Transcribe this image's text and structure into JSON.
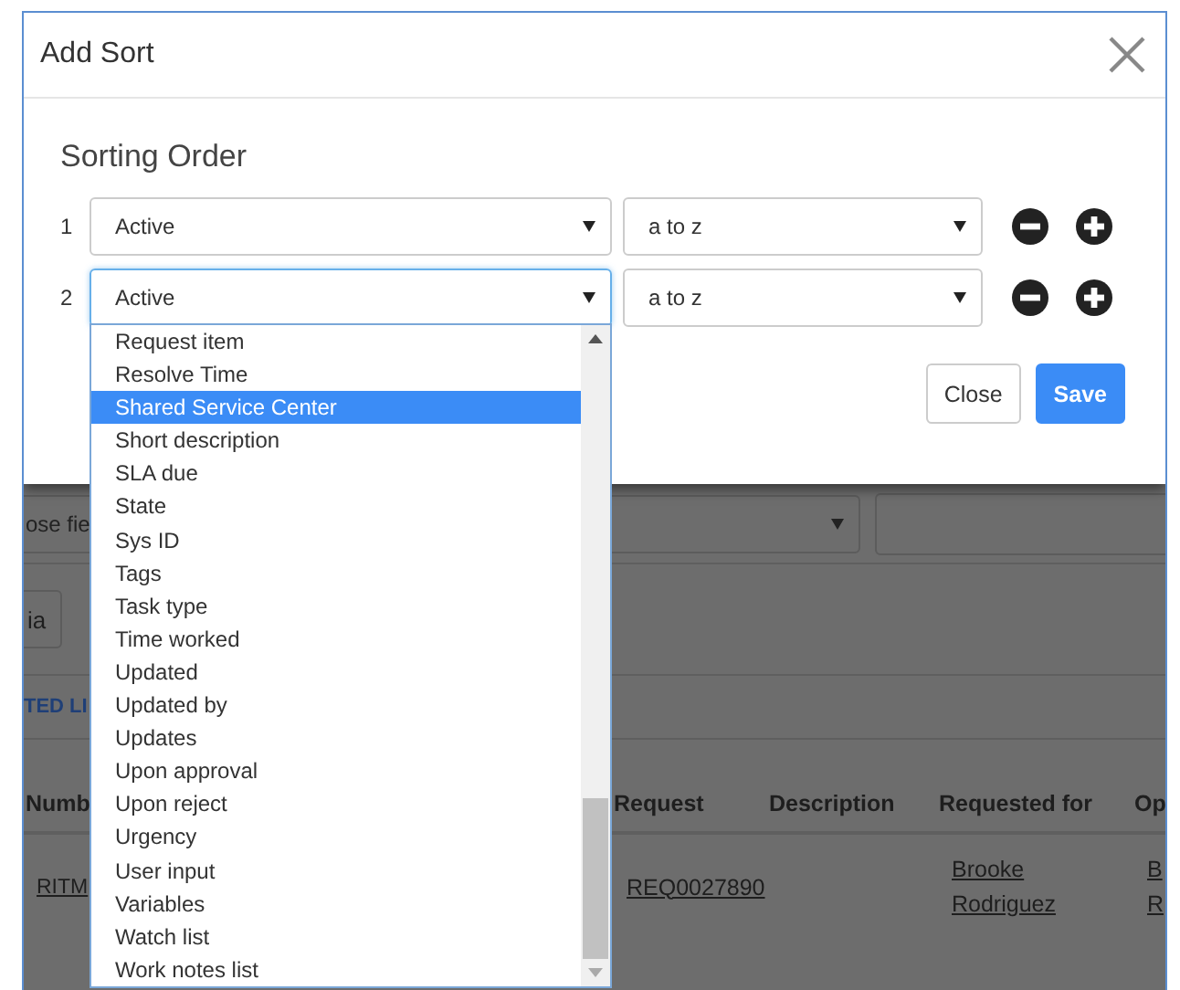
{
  "dialog": {
    "title": "Add Sort",
    "section_title": "Sorting Order",
    "sort_rows": [
      {
        "index": "1",
        "field": "Active",
        "direction": "a to z",
        "focused": false
      },
      {
        "index": "2",
        "field": "Active",
        "direction": "a to z",
        "focused": true
      }
    ],
    "buttons": [
      {
        "label": "Close",
        "kind": "secondary"
      },
      {
        "label": "Save",
        "kind": "primary"
      }
    ]
  },
  "field_dropdown": {
    "options": [
      {
        "label": "Request item",
        "selected": false
      },
      {
        "label": "Resolve Time",
        "selected": false
      },
      {
        "label": "Shared Service Center",
        "selected": true
      },
      {
        "label": "Short description",
        "selected": false
      },
      {
        "label": "SLA due",
        "selected": false
      },
      {
        "label": "State",
        "selected": false
      },
      {
        "label": "Sys ID",
        "selected": false
      },
      {
        "label": "Tags",
        "selected": false
      },
      {
        "label": "Task type",
        "selected": false
      },
      {
        "label": "Time worked",
        "selected": false
      },
      {
        "label": "Updated",
        "selected": false
      },
      {
        "label": "Updated by",
        "selected": false
      },
      {
        "label": "Updates",
        "selected": false
      },
      {
        "label": "Upon approval",
        "selected": false
      },
      {
        "label": "Upon reject",
        "selected": false
      },
      {
        "label": "Urgency",
        "selected": false
      },
      {
        "label": "User input",
        "selected": false
      },
      {
        "label": "Variables",
        "selected": false
      },
      {
        "label": "Watch list",
        "selected": false
      },
      {
        "label": "Work notes list",
        "selected": false
      }
    ]
  },
  "background_page": {
    "filter_field": {
      "value": "ose fie"
    },
    "button": "ia",
    "list_title": "TED LI",
    "table": {
      "columns": [
        "Numb",
        "Request",
        "Description",
        "Requested for",
        "Op"
      ],
      "rows": [
        {
          "cells": [
            [
              "RITM"
            ],
            [
              "REQ0027890"
            ],
            [],
            [
              "Brooke",
              "Rodriguez"
            ],
            [
              "B",
              "R"
            ]
          ]
        }
      ]
    }
  }
}
